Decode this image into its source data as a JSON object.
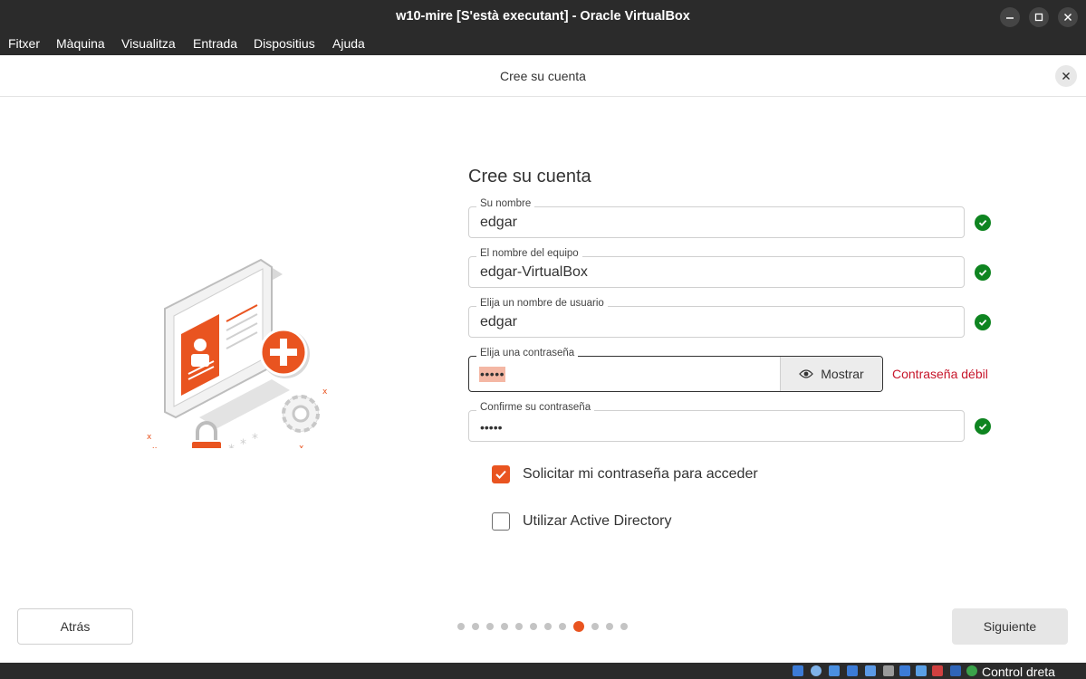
{
  "window": {
    "title": "w10-mire [S'està executant] - Oracle VirtualBox"
  },
  "menu": [
    "Fitxer",
    "Màquina",
    "Visualitza",
    "Entrada",
    "Dispositius",
    "Ajuda"
  ],
  "dialog": {
    "header_title": "Cree su cuenta",
    "heading": "Cree su cuenta",
    "fields": {
      "name": {
        "label": "Su nombre",
        "value": "edgar"
      },
      "computer": {
        "label": "El nombre del equipo",
        "value": "edgar-VirtualBox"
      },
      "username": {
        "label": "Elija un nombre de usuario",
        "value": "edgar"
      },
      "password": {
        "label": "Elija una contraseña",
        "value": "•••••",
        "show_label": "Mostrar",
        "strength": "Contraseña débil"
      },
      "confirm": {
        "label": "Confirme su contraseña",
        "value": "•••••"
      }
    },
    "options": {
      "require_password": {
        "label": "Solicitar mi contraseña para acceder",
        "checked": true
      },
      "active_directory": {
        "label": "Utilizar Active Directory",
        "checked": false
      }
    },
    "back_label": "Atrás",
    "next_label": "Siguiente",
    "progress": {
      "steps": 12,
      "current": 9
    }
  },
  "statusbar": {
    "host_key": "Control dreta"
  },
  "colors": {
    "accent": "#e95420",
    "success": "#0e8420",
    "error": "#c7162b"
  }
}
